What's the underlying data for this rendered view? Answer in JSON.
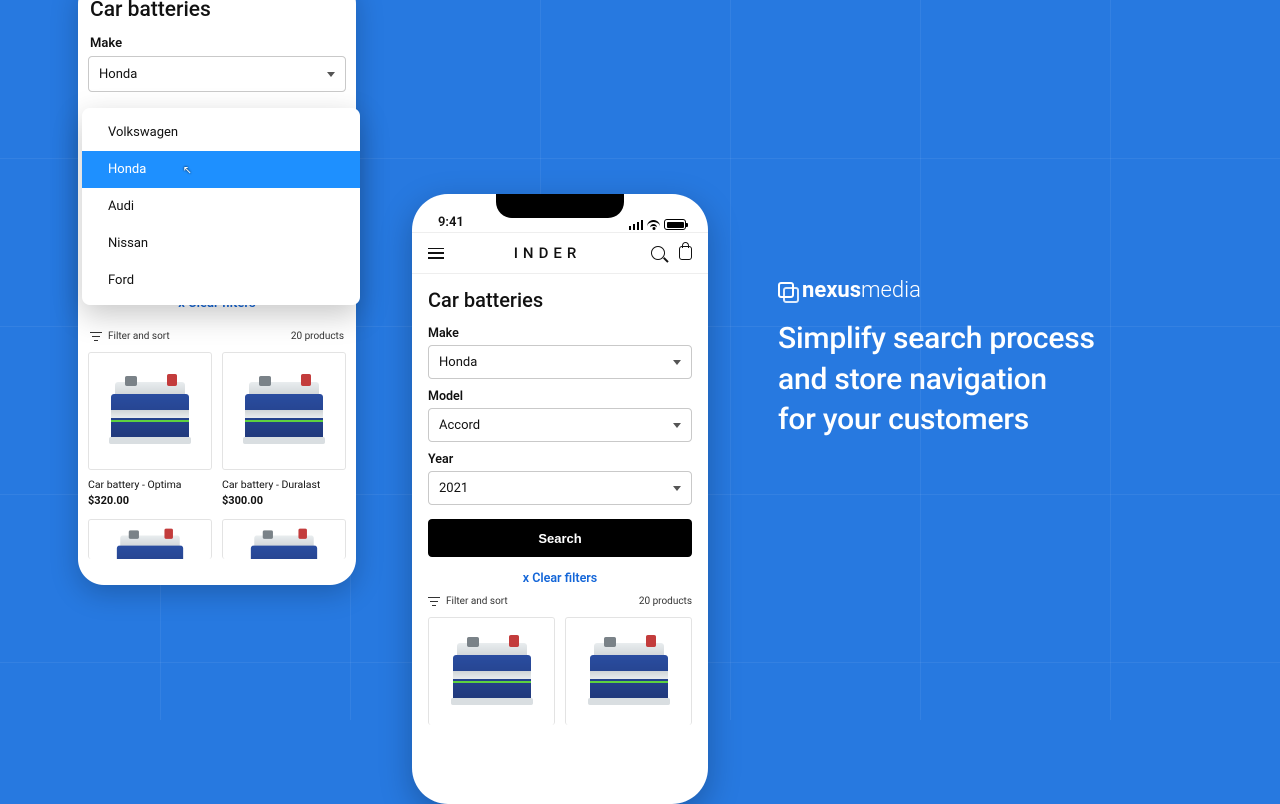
{
  "left": {
    "title": "Car batteries",
    "makeLabel": "Make",
    "makeValue": "Honda",
    "options": [
      "Volkswagen",
      "Honda",
      "Audi",
      "Nissan",
      "Ford"
    ],
    "selectedIndex": 1,
    "clear": "x Clear filters",
    "filterSort": "Filter and sort",
    "productCount": "20 products",
    "products": [
      {
        "name": "Car battery - Optima",
        "price": "$320.00"
      },
      {
        "name": "Car battery - Duralast",
        "price": "$300.00"
      }
    ]
  },
  "right": {
    "time": "9:41",
    "brand": "INDER",
    "title": "Car batteries",
    "makeLabel": "Make",
    "makeValue": "Honda",
    "modelLabel": "Model",
    "modelValue": "Accord",
    "yearLabel": "Year",
    "yearValue": "2021",
    "searchLabel": "Search",
    "clear": "x Clear filters",
    "filterSort": "Filter and sort",
    "productCount": "20 products"
  },
  "marketing": {
    "brand_bold": "nexus",
    "brand_light": "media",
    "line1": "Simplify search process",
    "line2": "and store navigation",
    "line3": "for your customers"
  }
}
